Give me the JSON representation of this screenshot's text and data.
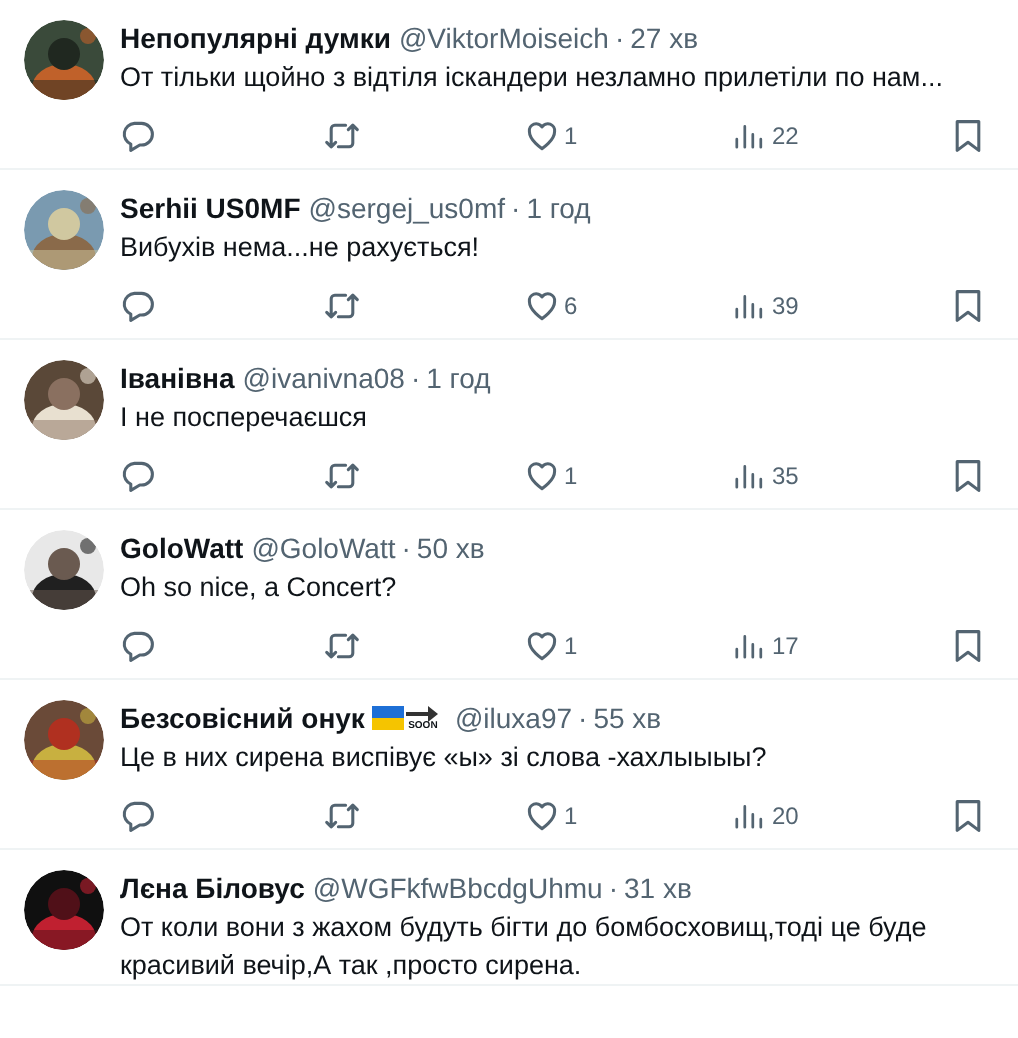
{
  "replies": [
    {
      "name": "Непопулярні думки",
      "handle": "@ViktorMoiseich",
      "dot": "·",
      "time": "27 хв",
      "text": "От тільки щойно з відтіля іскандери незламно прилетіли по нам...",
      "likes": "1",
      "views": "22"
    },
    {
      "name": "Serhii US0MF",
      "handle": "@sergej_us0mf",
      "dot": "·",
      "time": "1 год",
      "text": "Вибухів нема...не рахується!",
      "likes": "6",
      "views": "39"
    },
    {
      "name": "Іванівна",
      "handle": "@ivanivna08",
      "dot": "·",
      "time": "1 год",
      "text": "І не посперечаєшся",
      "likes": "1",
      "views": "35"
    },
    {
      "name": "GoloWatt",
      "handle": "@GoloWatt",
      "dot": "·",
      "time": "50 хв",
      "text": "Oh so nice, a Concert?",
      "likes": "1",
      "views": "17"
    },
    {
      "name": "Безсовісний онук",
      "badges": [
        {
          "kind": "flag"
        },
        {
          "kind": "arrow",
          "label": "SOON"
        }
      ],
      "handle": "@iluxa97",
      "dot": "·",
      "time": "55 хв",
      "text": "Це в них сирена виспівує «ы» зі слова -хахлыыыы?",
      "likes": "1",
      "views": "20"
    },
    {
      "name": "Лєна Біловус",
      "handle": "@WGFkfwBbcdgUhmu",
      "dot": "·",
      "time": "31 хв",
      "text": "От коли вони з жахом будуть бігти до бомбосховищ,тоді це буде красивий вечір,А так ,просто сирена."
    }
  ]
}
